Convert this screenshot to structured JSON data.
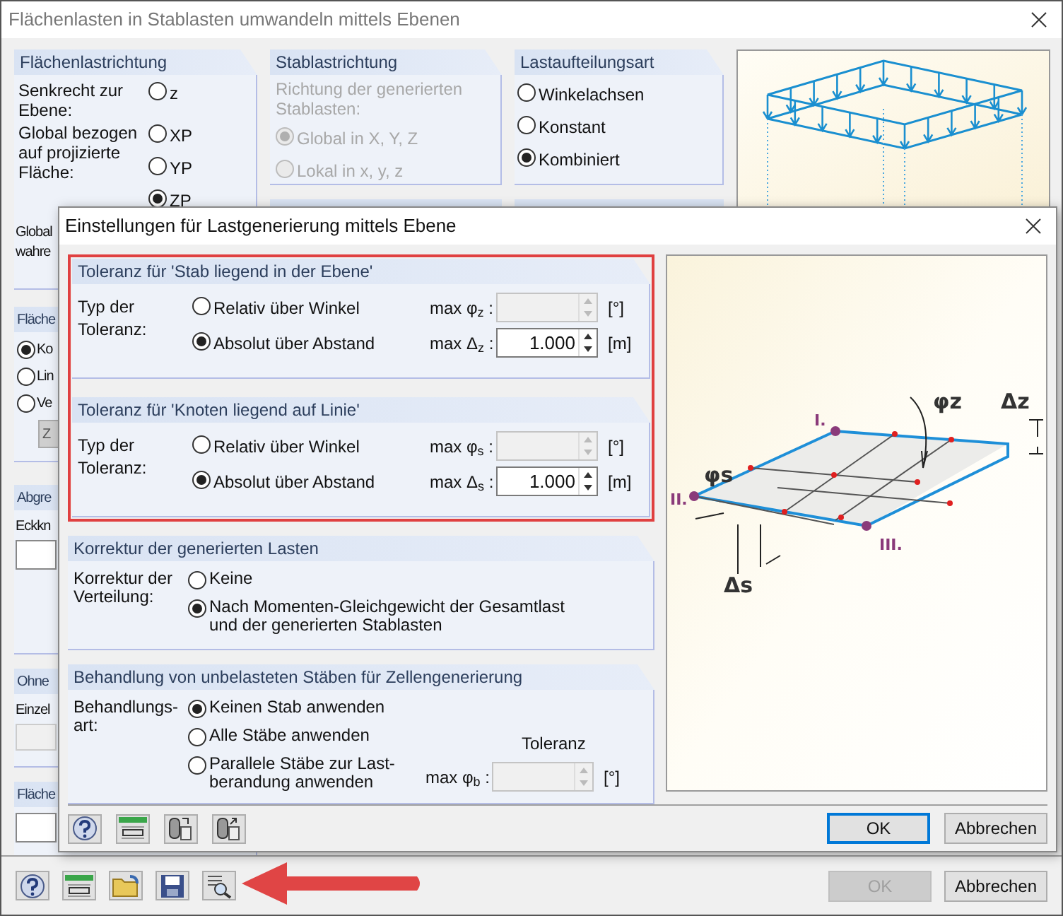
{
  "window": {
    "title": "Flächenlasten in Stablasten umwandeln mittels Ebenen"
  },
  "flaechenlastrichtung": {
    "title": "Flächenlastrichtung",
    "rows": [
      {
        "label": "Senkrecht zur Ebene:",
        "options": [
          {
            "label": "z",
            "selected": false
          }
        ]
      },
      {
        "label": "Global bezogen auf projizierte Fläche:",
        "options": [
          {
            "label": "XP",
            "selected": false
          },
          {
            "label": "YP",
            "selected": false
          },
          {
            "label": "ZP",
            "selected": true
          }
        ]
      }
    ],
    "cut_lines": [
      "Global",
      "wahre"
    ]
  },
  "stablastrichtung": {
    "title": "Stablastrichtung",
    "prompt": "Richtung der generierten Stablasten:",
    "disabled": true,
    "options": [
      {
        "label": "Global in X, Y, Z",
        "selected": true
      },
      {
        "label": "Lokal in x, y, z",
        "selected": false
      }
    ]
  },
  "lastaufteilungsart": {
    "title": "Lastaufteilungsart",
    "options": [
      {
        "label": "Winkelachsen",
        "selected": false
      },
      {
        "label": "Konstant",
        "selected": false
      },
      {
        "label": "Kombiniert",
        "selected": true
      }
    ]
  },
  "cut_groups": {
    "flaeche": {
      "title": "Fläche",
      "options": [
        {
          "label": "Ko",
          "selected": true
        },
        {
          "label": "Lin",
          "selected": false
        },
        {
          "label": "Ve",
          "selected": false
        }
      ],
      "button": "Z"
    },
    "abgrenzung": {
      "title": "Abgre",
      "label": "Eckkn"
    },
    "ohne": {
      "title": "Ohne",
      "label": "Einzel"
    },
    "flaeche2": {
      "title": "Fläche"
    }
  },
  "buttons": [
    {
      "label": "OK",
      "disabled": true
    },
    {
      "label": "Abbrechen",
      "disabled": false
    }
  ],
  "dialog": {
    "title": "Einstellungen für Lastgenerierung mittels Ebene",
    "tolerance_groups": [
      {
        "title": "Toleranz für 'Stab liegend in der Ebene'",
        "label": "Typ der Toleranz:",
        "rows": [
          {
            "option": "Relativ über Winkel",
            "selected": false,
            "param": "max φ$_{z}$ :",
            "disabled": true,
            "unit": "[°]"
          },
          {
            "option": "Absolut über Abstand",
            "selected": true,
            "param": "max Δ$_{z}$ :",
            "value": "1.000",
            "disabled": false,
            "unit": "[m]"
          }
        ]
      },
      {
        "title": "Toleranz für 'Knoten liegend auf Linie'",
        "label": "Typ der Toleranz:",
        "rows": [
          {
            "option": "Relativ über Winkel",
            "selected": false,
            "param": "max φ$_{s}$ :",
            "disabled": true,
            "unit": "[°]"
          },
          {
            "option": "Absolut über Abstand",
            "selected": true,
            "param": "max Δ$_{s}$ :",
            "value": "1.000",
            "disabled": false,
            "unit": "[m]"
          }
        ]
      }
    ],
    "correction": {
      "title": "Korrektur der generierten Lasten",
      "label": "Korrektur der Verteilung:",
      "options": [
        {
          "label": "Keine",
          "selected": false
        },
        {
          "label": "Nach Momenten-Gleichgewicht der Gesamtlast und der generierten Stablasten",
          "selected": true
        }
      ]
    },
    "treatment": {
      "title": "Behandlung von unbelasteten Stäben für Zellengenerierung",
      "label": "Behandlungs-art:",
      "options": [
        {
          "label": "Keinen Stab anwenden",
          "selected": true
        },
        {
          "label": "Alle Stäbe anwenden",
          "selected": false
        },
        {
          "label": "Parallele Stäbe zur Last-berandung anwenden",
          "selected": false
        }
      ],
      "tolerance": {
        "heading": "Toleranz",
        "param": "max φ$_{b}$ :",
        "disabled": true,
        "unit": "[°]"
      }
    },
    "figure_labels": [
      "I.",
      "II.",
      "III.",
      "φz",
      "Δz",
      "φs",
      "Δs"
    ],
    "buttons": [
      {
        "label": "OK",
        "default": true
      },
      {
        "label": "Abbrechen",
        "default": false
      }
    ]
  }
}
